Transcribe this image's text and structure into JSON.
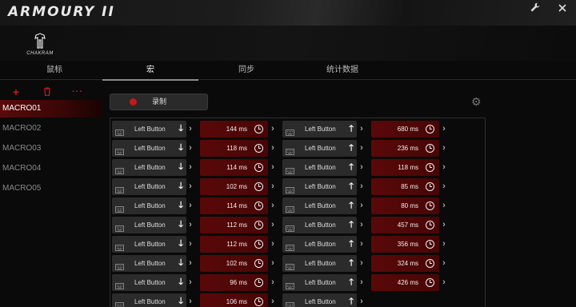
{
  "app": {
    "title": "ARMOURY II"
  },
  "window": {
    "tool_icon": "wrench-icon",
    "close_icon": "close-icon"
  },
  "device": {
    "name": "CHAKRAM",
    "icon": "mouse-logo-icon"
  },
  "tabs": [
    {
      "label": "鼠标",
      "active": false
    },
    {
      "label": "宏",
      "active": true
    },
    {
      "label": "同步",
      "active": false
    },
    {
      "label": "统计数据",
      "active": false
    }
  ],
  "sidebar": {
    "tools": [
      "+",
      "🗑",
      "···"
    ],
    "macros": [
      {
        "label": "MACRO01",
        "active": true
      },
      {
        "label": "MACRO02",
        "active": false
      },
      {
        "label": "MACRO03",
        "active": false
      },
      {
        "label": "MACRO04",
        "active": false
      },
      {
        "label": "MACRO05",
        "active": false
      }
    ]
  },
  "record": {
    "label": "录制"
  },
  "colors": {
    "accent": "#c41a1a",
    "delay_bg": "#5a0808",
    "key_bg": "#2b2b2b"
  },
  "events": [
    {
      "key": "Left Button",
      "dir": "down",
      "delay": "144 ms"
    },
    {
      "key": "Left Button",
      "dir": "up",
      "delay": "680 ms"
    },
    {
      "key": "Left Button",
      "dir": "down",
      "delay": "118 ms"
    },
    {
      "key": "Left Button",
      "dir": "up",
      "delay": "236 ms"
    },
    {
      "key": "Left Button",
      "dir": "down",
      "delay": "114 ms"
    },
    {
      "key": "Left Button",
      "dir": "up",
      "delay": "118 ms"
    },
    {
      "key": "Left Button",
      "dir": "down",
      "delay": "102 ms"
    },
    {
      "key": "Left Button",
      "dir": "up",
      "delay": "85 ms"
    },
    {
      "key": "Left Button",
      "dir": "down",
      "delay": "114 ms"
    },
    {
      "key": "Left Button",
      "dir": "up",
      "delay": "80 ms"
    },
    {
      "key": "Left Button",
      "dir": "down",
      "delay": "112 ms"
    },
    {
      "key": "Left Button",
      "dir": "up",
      "delay": "457 ms"
    },
    {
      "key": "Left Button",
      "dir": "down",
      "delay": "112 ms"
    },
    {
      "key": "Left Button",
      "dir": "up",
      "delay": "356 ms"
    },
    {
      "key": "Left Button",
      "dir": "down",
      "delay": "102 ms"
    },
    {
      "key": "Left Button",
      "dir": "up",
      "delay": "324 ms"
    },
    {
      "key": "Left Button",
      "dir": "down",
      "delay": "96 ms"
    },
    {
      "key": "Left Button",
      "dir": "up",
      "delay": "426 ms"
    },
    {
      "key": "Left Button",
      "dir": "down",
      "delay": "106 ms"
    },
    {
      "key": "Left Button",
      "dir": "up",
      "delay": ""
    }
  ]
}
